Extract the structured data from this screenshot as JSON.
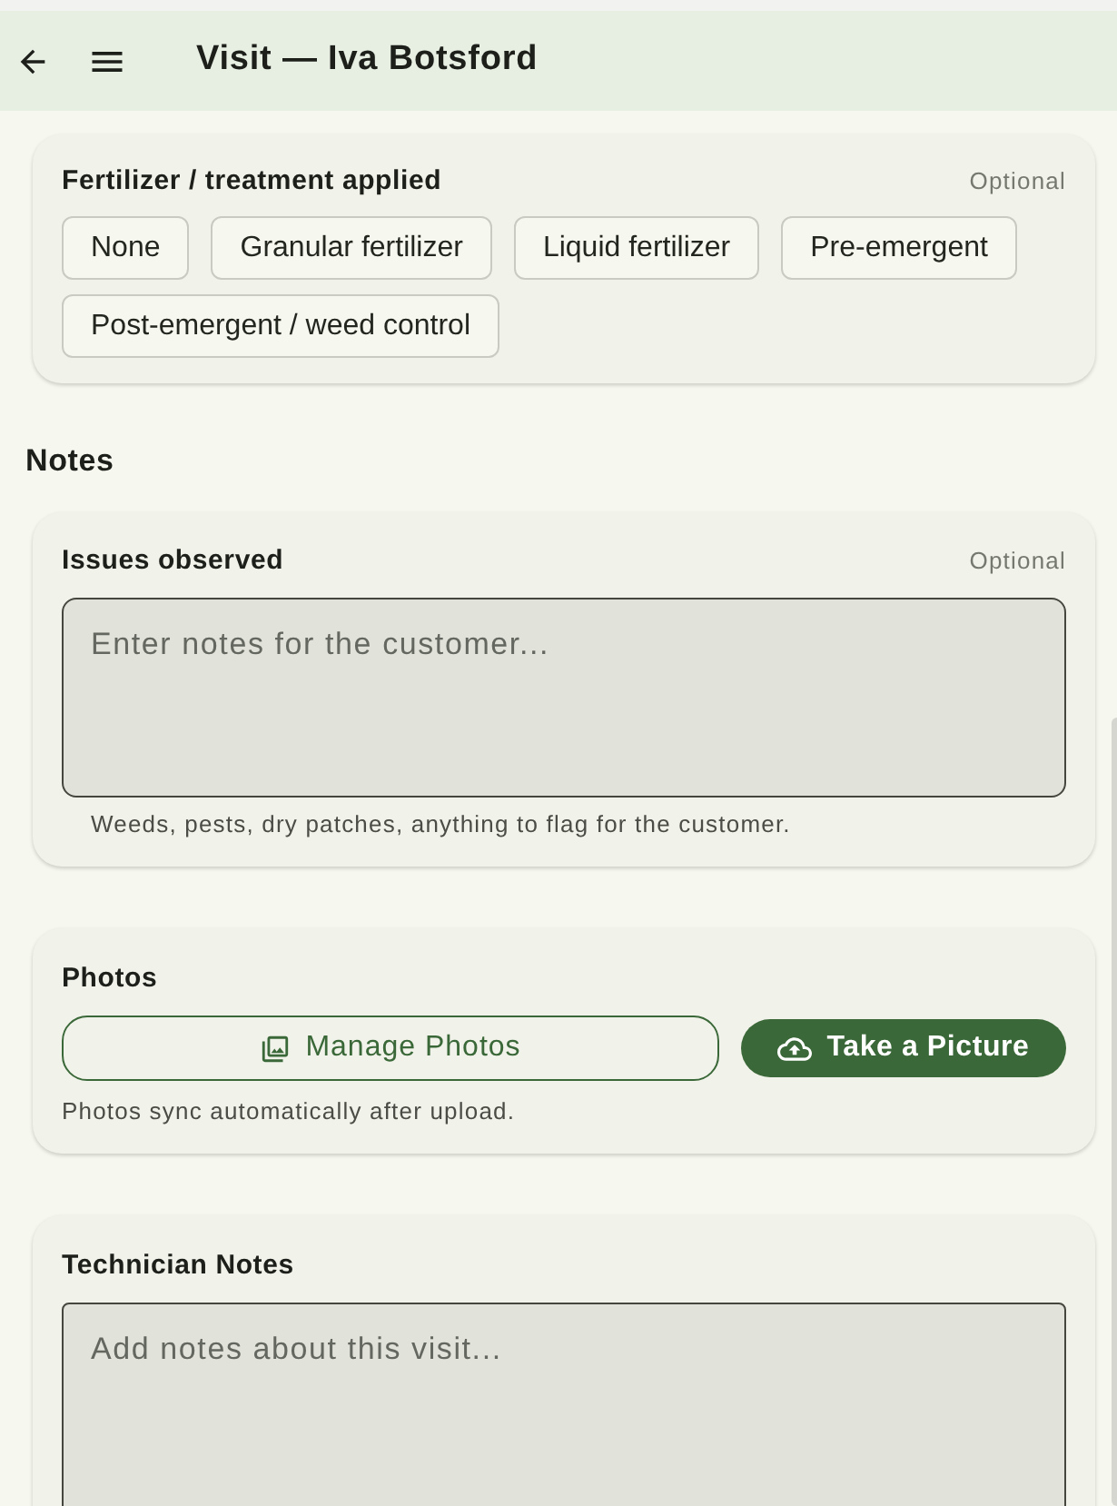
{
  "header": {
    "title": "Visit — Iva Botsford"
  },
  "fertilizer": {
    "label": "Fertilizer / treatment applied",
    "optional": "Optional",
    "options": [
      {
        "label": "None",
        "selected": false
      },
      {
        "label": "Granular fertilizer",
        "selected": false
      },
      {
        "label": "Liquid fertilizer",
        "selected": false
      },
      {
        "label": "Pre-emergent",
        "selected": false
      },
      {
        "label": "Post-emergent / weed control",
        "selected": false
      }
    ]
  },
  "notes_heading": "Notes",
  "issues": {
    "label": "Issues observed",
    "optional": "Optional",
    "placeholder": "Enter notes for the customer...",
    "hint": "Weeds, pests, dry patches, anything to flag for the customer."
  },
  "photos": {
    "label": "Photos",
    "buttons": [
      {
        "label": "Manage Photos",
        "kind": "outline"
      },
      {
        "label": "Take a Picture",
        "kind": "filled"
      }
    ],
    "hint": "Photos sync automatically after upload."
  },
  "technician_notes": {
    "label": "Technician Notes",
    "placeholder": "Add notes about this visit..."
  }
}
